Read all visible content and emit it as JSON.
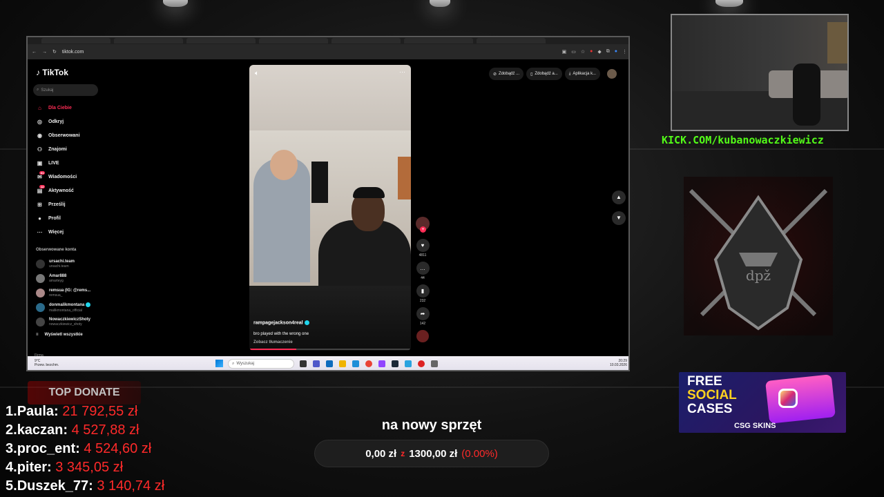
{
  "browser": {
    "url": "tiktok.com"
  },
  "tiktok": {
    "logo": "TikTok",
    "search_placeholder": "Szukaj",
    "nav": [
      {
        "label": "Dla Ciebie",
        "icon": "home-icon",
        "active": true
      },
      {
        "label": "Odkryj",
        "icon": "compass-icon"
      },
      {
        "label": "Obserwowani",
        "icon": "following-icon"
      },
      {
        "label": "Znajomi",
        "icon": "friends-icon"
      },
      {
        "label": "LIVE",
        "icon": "live-icon"
      },
      {
        "label": "Wiadomości",
        "icon": "messages-icon",
        "badge": "61"
      },
      {
        "label": "Aktywność",
        "icon": "activity-icon",
        "badge": "12"
      },
      {
        "label": "Prześlij",
        "icon": "upload-icon"
      },
      {
        "label": "Profil",
        "icon": "profile-icon"
      },
      {
        "label": "Więcej",
        "icon": "more-icon"
      }
    ],
    "followed_title": "Obserwowane konta",
    "followed": [
      {
        "name": "ursachi.team",
        "handle": "ursachi.team"
      },
      {
        "name": "Amar888",
        "handle": "amarteyg"
      },
      {
        "name": "remsua (IG: @rems...",
        "handle": "remsua_"
      },
      {
        "name": "donmalikmontana",
        "handle": "malikmontana_official"
      },
      {
        "name": "NowaczkiewiczShoty",
        "handle": "nowaczkiewicz_shoty"
      }
    ],
    "show_all": "Wyświetl wszystkie",
    "company": "Firma",
    "top_buttons": [
      "Zdobądź ...",
      "Zdobądź a...",
      "Aplikacja k..."
    ],
    "video": {
      "author": "rampagejackson4real",
      "description": "bro played with the wrong one",
      "translate": "Zobacz tłumaczenie",
      "progress": 0.29
    },
    "actions": {
      "likes": "4811",
      "comments": "44",
      "saves": "232",
      "shares": "142"
    }
  },
  "taskbar": {
    "weather_temp": "9°C",
    "weather_desc": "Przew. bezchm.",
    "search": "Wyszukaj",
    "time": "20:29",
    "date": "10.03.2026"
  },
  "overlay": {
    "kick_url": "KICK.COM/kubanowaczkiewicz",
    "ad": {
      "line1": "FREE",
      "line2": "SOCIAL",
      "line3": "CASES",
      "brand": "CSG SKINS"
    },
    "top_donate_title": "TOP DONATE",
    "donors": [
      {
        "rank": "1.",
        "name": "Paula:",
        "amount": "21 792,55 zł"
      },
      {
        "rank": "2.",
        "name": "kaczan:",
        "amount": "4 527,88 zł"
      },
      {
        "rank": "3.",
        "name": "proc_ent:",
        "amount": "4 524,60 zł"
      },
      {
        "rank": "4.",
        "name": "piter:",
        "amount": "3 345,05 zł"
      },
      {
        "rank": "5.",
        "name": "Duszek_77:",
        "amount": "3 140,74 zł"
      }
    ],
    "goal": {
      "title": "na nowy sprzęt",
      "current": "0,00 zł",
      "sep": "z",
      "target": "1300,00 zł",
      "percent": "(0.00%)"
    }
  }
}
